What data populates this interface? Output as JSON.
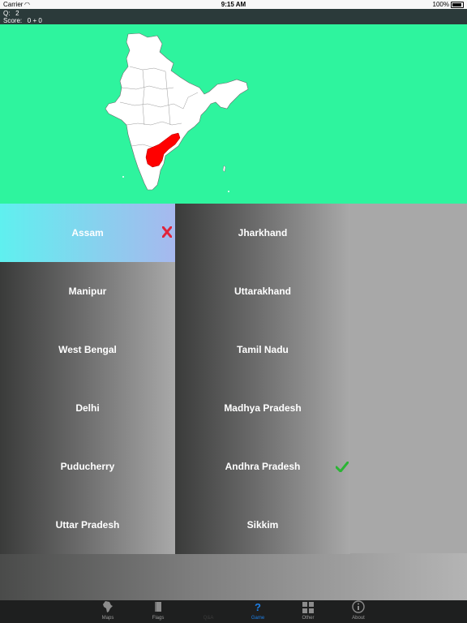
{
  "status_bar": {
    "carrier": "Carrier",
    "time": "9:15 AM",
    "battery": "100%"
  },
  "game_info": {
    "question_label": "Q:",
    "question_number": "2",
    "score_label": "Score:",
    "score_value": "0 + 0"
  },
  "map": {
    "land_color": "#ffffff",
    "highlight_color": "#ff0000",
    "background_color": "#2ef49e"
  },
  "answers": {
    "left": [
      "Assam",
      "Manipur",
      "West Bengal",
      "Delhi",
      "Puducherry",
      "Uttar Pradesh"
    ],
    "right": [
      "Jharkhand",
      "Uttarakhand",
      "Tamil Nadu",
      "Madhya Pradesh",
      "Andhra Pradesh",
      "Sikkim"
    ],
    "selected": "Assam",
    "wrong": "Assam",
    "correct": "Andhra Pradesh"
  },
  "tabs": [
    {
      "label": "Maps",
      "icon": "india-map-icon",
      "state": "normal"
    },
    {
      "label": "Flags",
      "icon": "flag-book-icon",
      "state": "normal"
    },
    {
      "label": "Q&A",
      "icon": "qa-icon",
      "state": "disabled"
    },
    {
      "label": "Game",
      "icon": "question-mark-icon",
      "state": "active"
    },
    {
      "label": "Other",
      "icon": "grid-icon",
      "state": "normal"
    },
    {
      "label": "About",
      "icon": "info-icon",
      "state": "normal"
    }
  ]
}
